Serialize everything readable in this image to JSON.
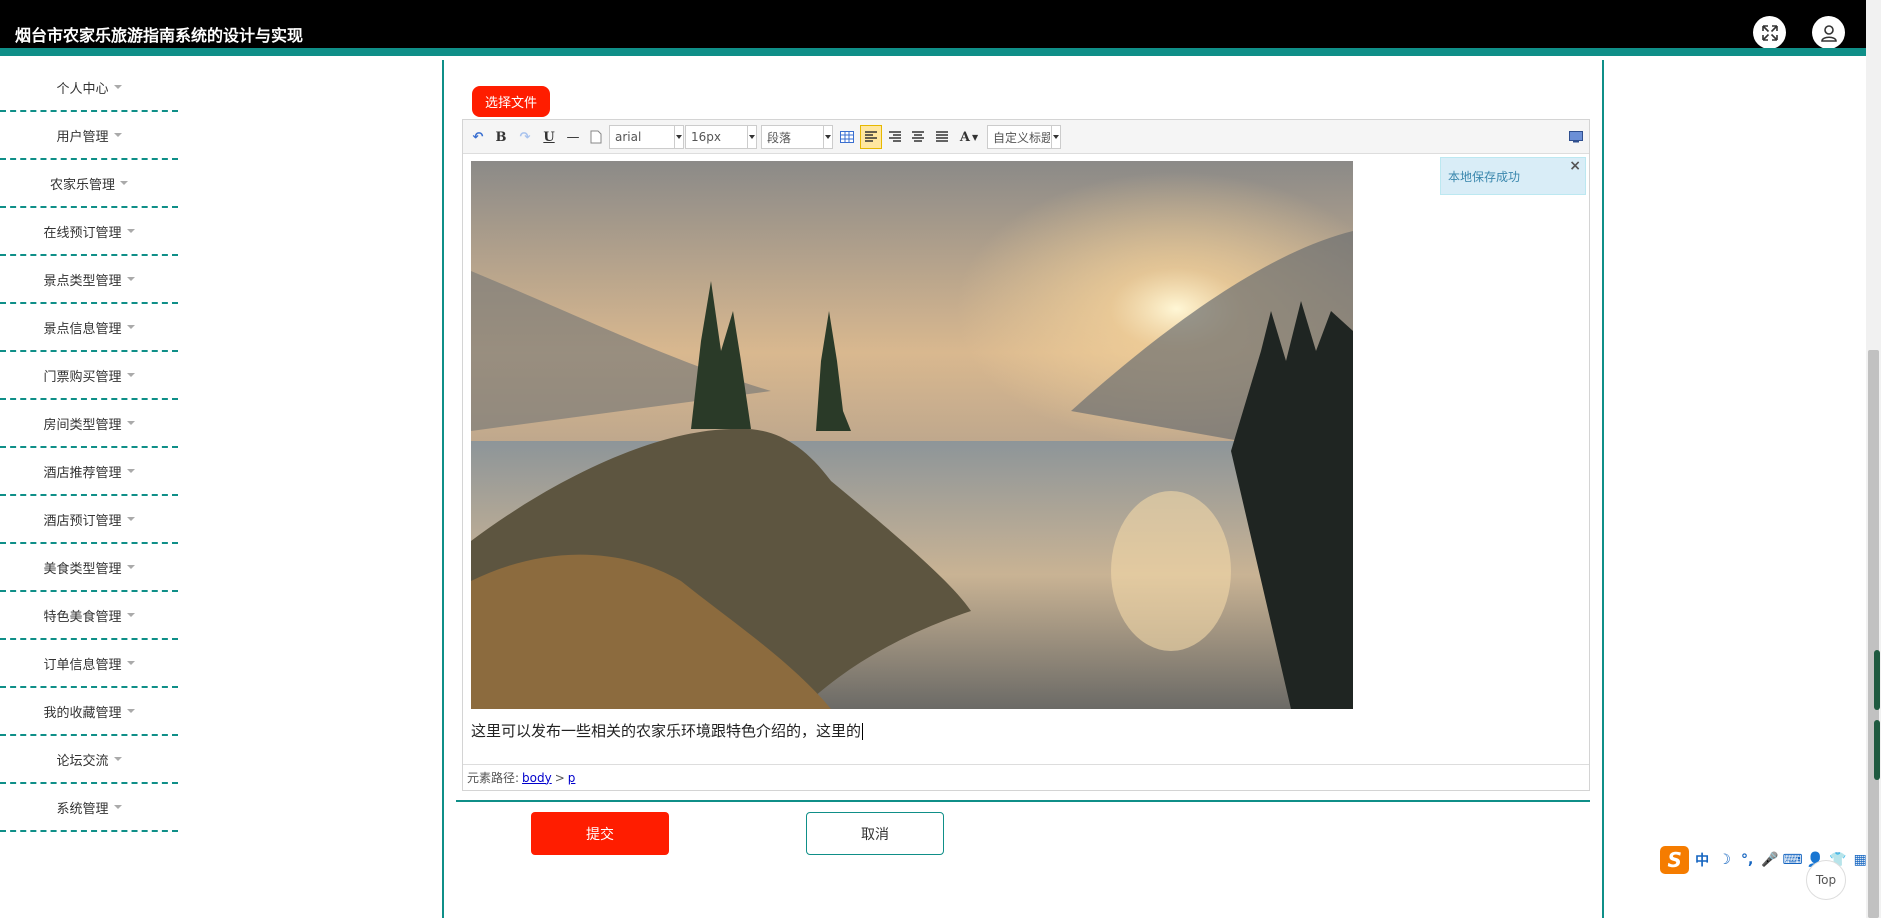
{
  "header": {
    "title": "烟台市农家乐旅游指南系统的设计与实现",
    "fullscreen_icon": "expand-arrows-icon",
    "user_icon": "user-avatar-icon"
  },
  "sidebar": {
    "items": [
      {
        "label": "个人中心"
      },
      {
        "label": "用户管理"
      },
      {
        "label": "农家乐管理"
      },
      {
        "label": "在线预订管理"
      },
      {
        "label": "景点类型管理"
      },
      {
        "label": "景点信息管理"
      },
      {
        "label": "门票购买管理"
      },
      {
        "label": "房间类型管理"
      },
      {
        "label": "酒店推荐管理"
      },
      {
        "label": "酒店预订管理"
      },
      {
        "label": "美食类型管理"
      },
      {
        "label": "特色美食管理"
      },
      {
        "label": "订单信息管理"
      },
      {
        "label": "我的收藏管理"
      },
      {
        "label": "论坛交流"
      },
      {
        "label": "系统管理"
      }
    ]
  },
  "form": {
    "choose_file_label": "选择文件",
    "submit_label": "提交",
    "cancel_label": "取消"
  },
  "editor": {
    "toolbar": {
      "undo": "↶",
      "bold": "B",
      "redo": "↷",
      "underline": "U",
      "hr": "—",
      "font_family": "arial",
      "font_size": "16px",
      "paragraph": "段落",
      "font_color": "A",
      "custom_title": "自定义标题"
    },
    "content_text": "这里可以发布一些相关的农家乐环境跟特色介绍的，这里的",
    "status_prefix": "元素路径:",
    "status_path": [
      "body",
      "p"
    ],
    "status_sep": ">",
    "toast": "本地保存成功",
    "toast_close": "×"
  },
  "ime": {
    "logo": "S",
    "items": [
      "中",
      "☽",
      "°,",
      "🎤",
      "⌨",
      "👤",
      "👕",
      "▦"
    ]
  },
  "top_button": "Top",
  "colors": {
    "accent_teal": "#0f8f88",
    "button_red": "#ff1d00",
    "header_black": "#000000",
    "toast_bg": "#d9edf7"
  }
}
